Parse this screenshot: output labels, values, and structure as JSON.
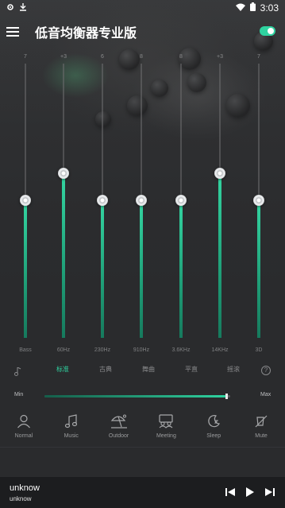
{
  "status_bar": {
    "time": "3:03"
  },
  "toolbar": {
    "title": "低音均衡器专业版",
    "power_on": true
  },
  "equalizer": {
    "bands": [
      {
        "top_label": "7",
        "label": "Bass",
        "level": 0.5
      },
      {
        "top_label": "+3",
        "label": "60Hz",
        "level": 0.6
      },
      {
        "top_label": "6",
        "label": "230Hz",
        "level": 0.5
      },
      {
        "top_label": "8",
        "label": "910Hz",
        "level": 0.5
      },
      {
        "top_label": "8",
        "label": "3.6KHz",
        "level": 0.5
      },
      {
        "top_label": "+3",
        "label": "14KHz",
        "level": 0.6
      },
      {
        "top_label": "7",
        "label": "3D",
        "level": 0.5
      }
    ]
  },
  "presets": {
    "items": [
      "标准",
      "古典",
      "舞曲",
      "平直",
      "摇滚"
    ],
    "active_index": 0,
    "help_label": "?"
  },
  "volume": {
    "min_label": "Min",
    "max_label": "Max",
    "level": 0.98
  },
  "modes": [
    {
      "label": "Normal",
      "icon": "person-icon"
    },
    {
      "label": "Music",
      "icon": "music-note-icon"
    },
    {
      "label": "Outdoor",
      "icon": "beach-umbrella-icon"
    },
    {
      "label": "Meeting",
      "icon": "meeting-people-icon"
    },
    {
      "label": "Sleep",
      "icon": "moon-icon"
    },
    {
      "label": "Mute",
      "icon": "mute-icon"
    }
  ],
  "player": {
    "title": "unknow",
    "artist": "unknow"
  },
  "colors": {
    "accent": "#2fd3a0",
    "background": "#2a2b2d",
    "player_bg": "#1c1d1f"
  }
}
